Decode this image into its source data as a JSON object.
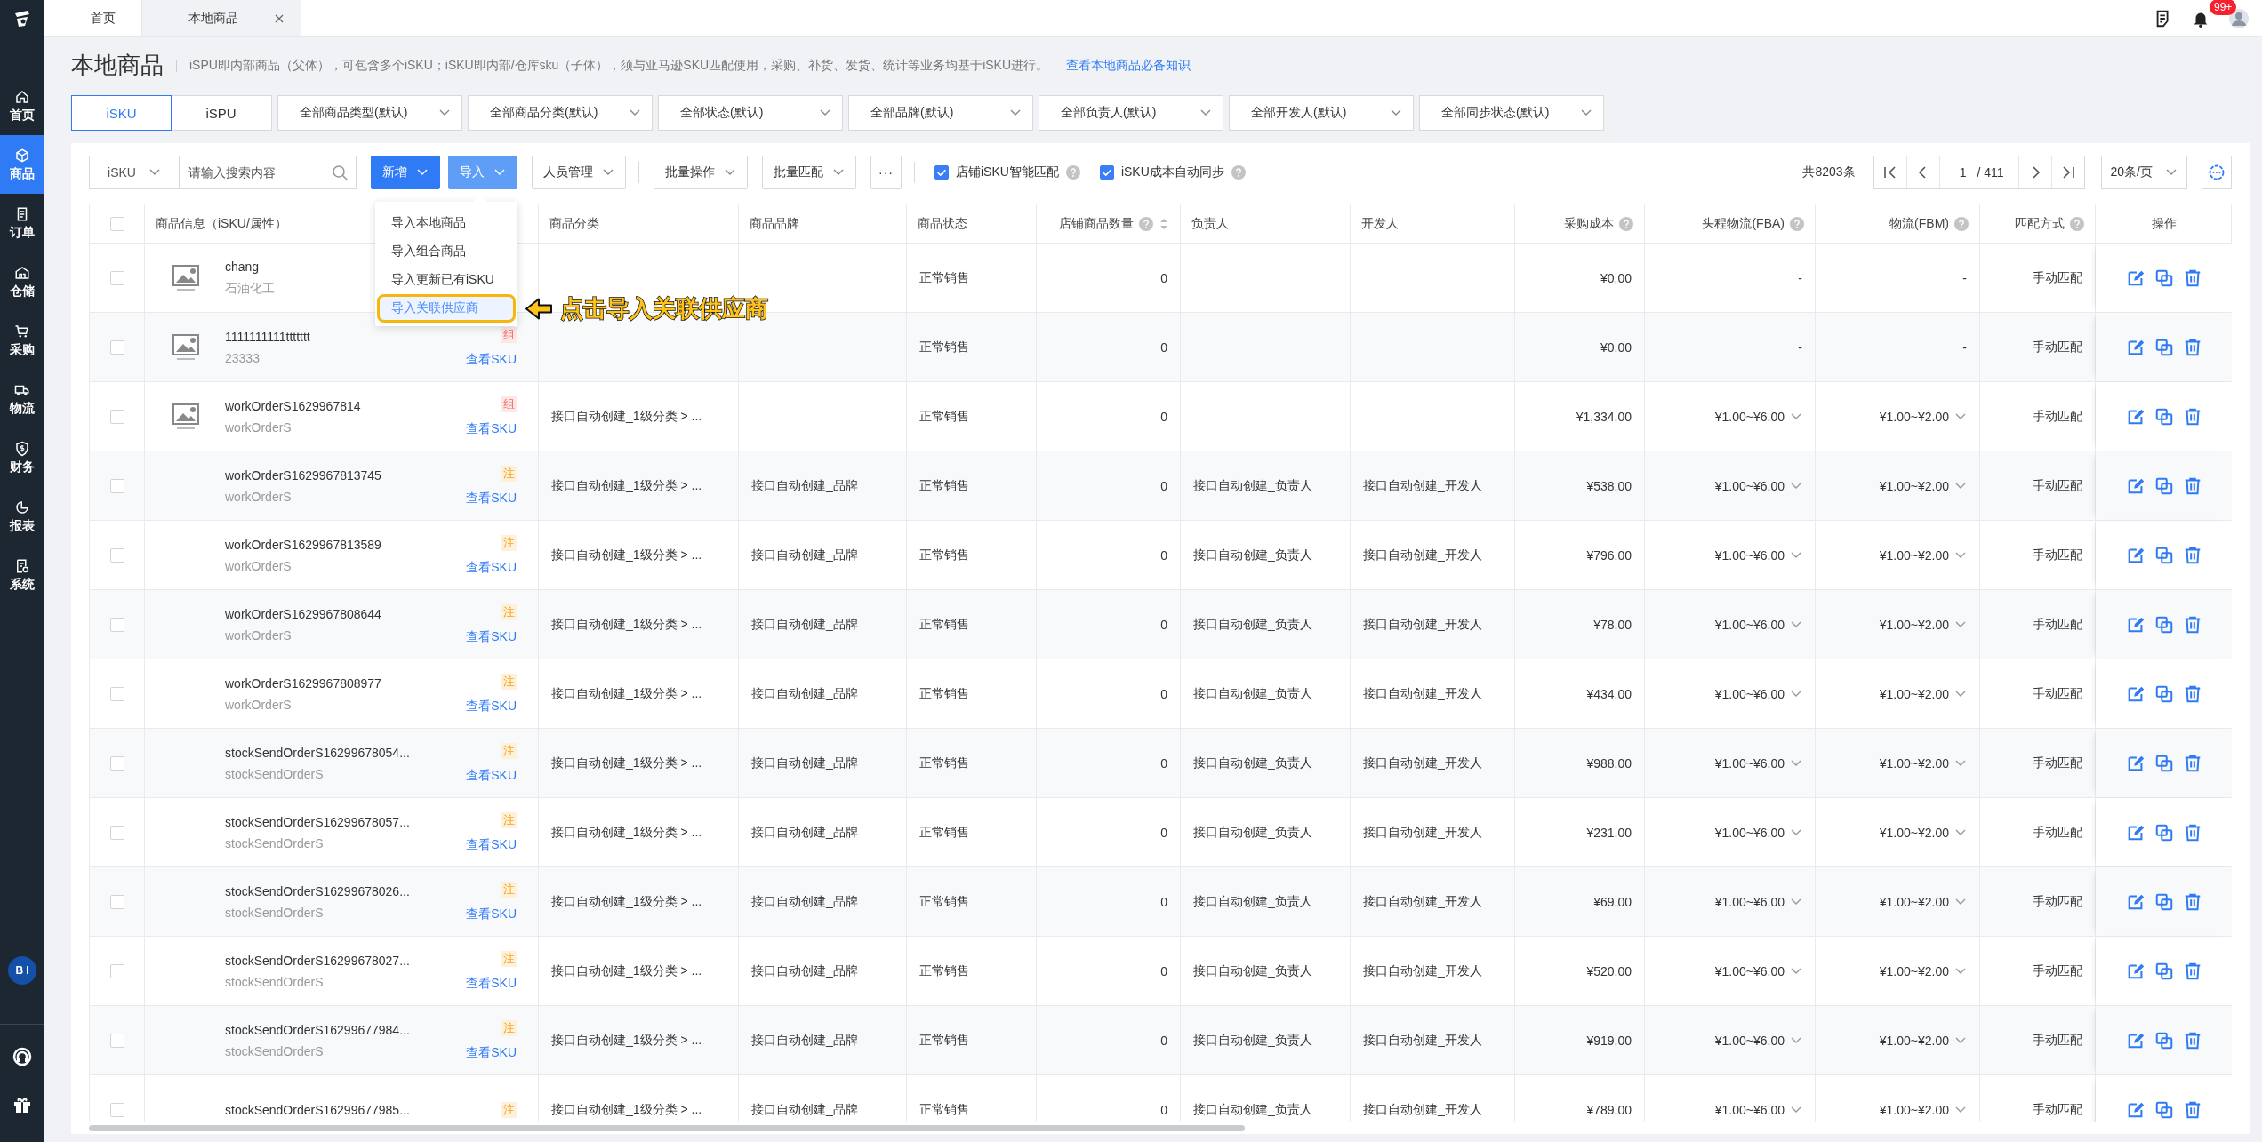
{
  "top_bar": {
    "tabs": [
      {
        "label": "首页",
        "selected": false,
        "closable": false
      },
      {
        "label": "本地商品",
        "selected": true,
        "closable": true
      }
    ],
    "notification_badge": "99+"
  },
  "sidebar": {
    "items": [
      {
        "label": "首页",
        "kind": "home",
        "selected": false
      },
      {
        "label": "商品",
        "kind": "cube",
        "selected": true
      },
      {
        "label": "订单",
        "kind": "order",
        "selected": false
      },
      {
        "label": "仓储",
        "kind": "warehouse",
        "selected": false
      },
      {
        "label": "采购",
        "kind": "cart",
        "selected": false
      },
      {
        "label": "物流",
        "kind": "truck",
        "selected": false
      },
      {
        "label": "财务",
        "kind": "finance",
        "selected": false
      },
      {
        "label": "报表",
        "kind": "chart",
        "selected": false
      },
      {
        "label": "系统",
        "kind": "system",
        "selected": false
      }
    ],
    "bi_badge": "BI"
  },
  "page_header": {
    "title": "本地商品",
    "description": "iSPU即内部商品（父体），可包含多个iSKU；iSKU即内部/仓库sku（子体），须与亚马逊SKU匹配使用，采购、补货、发货、统计等业务均基于iSKU进行。",
    "link": "查看本地商品必备知识"
  },
  "filters": {
    "segments": [
      {
        "label": "iSKU",
        "selected": true
      },
      {
        "label": "iSPU",
        "selected": false
      }
    ],
    "dropdowns": [
      "全部商品类型(默认)",
      "全部商品分类(默认)",
      "全部状态(默认)",
      "全部品牌(默认)",
      "全部负责人(默认)",
      "全部开发人(默认)",
      "全部同步状态(默认)"
    ]
  },
  "toolbar": {
    "search_scope": "iSKU",
    "search": {
      "placeholder": "请输入搜索内容"
    },
    "buttons": [
      {
        "label": "新增",
        "kind": "primary",
        "divider_before": false
      },
      {
        "label": "导入",
        "kind": "light",
        "divider_before": false
      },
      {
        "label": "人员管理",
        "kind": "dropdown",
        "divider_before": false
      },
      {
        "label": "批量操作",
        "kind": "dropdown",
        "divider_before": true
      },
      {
        "label": "批量匹配",
        "kind": "dropdown",
        "divider_before": false
      },
      {
        "label": "···",
        "kind": "plain",
        "divider_before": false
      }
    ],
    "checkboxes": [
      {
        "label": "店铺iSKU智能匹配",
        "checked": true,
        "help": true
      },
      {
        "label": "iSKU成本自动同步",
        "checked": true,
        "help": true
      }
    ],
    "pagination": {
      "total": "共8203条",
      "page": "1",
      "pages": "/ 411",
      "page_size": "20条/页"
    }
  },
  "import_menu": {
    "items": [
      {
        "label": "导入本地商品",
        "selected": false
      },
      {
        "label": "导入组合商品",
        "selected": false
      },
      {
        "label": "导入更新已有iSKU",
        "selected": false
      },
      {
        "label": "导入关联供应商",
        "selected": true
      }
    ],
    "callout": "点击导入关联供应商"
  },
  "table": {
    "columns": [
      {
        "kind": "checkbox",
        "checked": false
      },
      {
        "label": "商品信息（iSKU/属性）",
        "help": false,
        "sortable": false
      },
      {
        "label": "商品分类",
        "help": false,
        "sortable": false
      },
      {
        "label": "商品品牌",
        "help": false,
        "sortable": false
      },
      {
        "label": "商品状态",
        "help": false,
        "sortable": false
      },
      {
        "label": "店铺商品数量",
        "help": true,
        "sortable": true
      },
      {
        "label": "负责人",
        "help": false,
        "sortable": false
      },
      {
        "label": "开发人",
        "help": false,
        "sortable": false
      },
      {
        "label": "采购成本",
        "help": true,
        "sortable": false
      },
      {
        "label": "头程物流(FBA)",
        "help": true,
        "sortable": false
      },
      {
        "label": "物流(FBM)",
        "help": true,
        "sortable": false
      },
      {
        "label": "匹配方式",
        "help": true,
        "sortable": false
      },
      {
        "label": "操作",
        "help": false,
        "sortable": false
      }
    ],
    "rows": [
      {
        "checked": false,
        "has_image": true,
        "name": "chang",
        "sub": "石油化工",
        "status": "正常销售",
        "store_count": "0",
        "cost": "¥0.00",
        "fba": {
          "text": "-",
          "expandable": false
        },
        "fbm": {
          "text": "-",
          "expandable": false
        },
        "match": "手动匹配"
      },
      {
        "checked": false,
        "has_image": true,
        "name": "1111111111ttttttt",
        "sub": "23333",
        "tag": {
          "text": "组",
          "kind": "combo"
        },
        "link": "查看SKU",
        "status": "正常销售",
        "store_count": "0",
        "cost": "¥0.00",
        "fba": {
          "text": "-",
          "expandable": false
        },
        "fbm": {
          "text": "-",
          "expandable": false
        },
        "match": "手动匹配"
      },
      {
        "checked": false,
        "has_image": true,
        "name": "workOrderS1629967814",
        "sub": "workOrderS",
        "tag": {
          "text": "组",
          "kind": "combo"
        },
        "link": "查看SKU",
        "category": "接口自动创建_1级分类 > ...",
        "status": "正常销售",
        "store_count": "0",
        "cost": "¥1,334.00",
        "fba": {
          "text": "¥1.00~¥6.00",
          "expandable": true
        },
        "fbm": {
          "text": "¥1.00~¥2.00",
          "expandable": true
        },
        "match": "手动匹配"
      },
      {
        "checked": false,
        "has_image": false,
        "name": "workOrderS1629967813745",
        "sub": "workOrderS",
        "tag": {
          "text": "注",
          "kind": "note"
        },
        "link": "查看SKU",
        "category": "接口自动创建_1级分类 > ...",
        "brand": "接口自动创建_品牌",
        "status": "正常销售",
        "store_count": "0",
        "owner": "接口自动创建_负责人",
        "developer": "接口自动创建_开发人",
        "cost": "¥538.00",
        "fba": {
          "text": "¥1.00~¥6.00",
          "expandable": true
        },
        "fbm": {
          "text": "¥1.00~¥2.00",
          "expandable": true
        },
        "match": "手动匹配"
      },
      {
        "checked": false,
        "has_image": false,
        "name": "workOrderS1629967813589",
        "sub": "workOrderS",
        "tag": {
          "text": "注",
          "kind": "note"
        },
        "link": "查看SKU",
        "category": "接口自动创建_1级分类 > ...",
        "brand": "接口自动创建_品牌",
        "status": "正常销售",
        "store_count": "0",
        "owner": "接口自动创建_负责人",
        "developer": "接口自动创建_开发人",
        "cost": "¥796.00",
        "fba": {
          "text": "¥1.00~¥6.00",
          "expandable": true
        },
        "fbm": {
          "text": "¥1.00~¥2.00",
          "expandable": true
        },
        "match": "手动匹配"
      },
      {
        "checked": false,
        "has_image": false,
        "name": "workOrderS1629967808644",
        "sub": "workOrderS",
        "tag": {
          "text": "注",
          "kind": "note"
        },
        "link": "查看SKU",
        "category": "接口自动创建_1级分类 > ...",
        "brand": "接口自动创建_品牌",
        "status": "正常销售",
        "store_count": "0",
        "owner": "接口自动创建_负责人",
        "developer": "接口自动创建_开发人",
        "cost": "¥78.00",
        "fba": {
          "text": "¥1.00~¥6.00",
          "expandable": true
        },
        "fbm": {
          "text": "¥1.00~¥2.00",
          "expandable": true
        },
        "match": "手动匹配"
      },
      {
        "checked": false,
        "has_image": false,
        "name": "workOrderS1629967808977",
        "sub": "workOrderS",
        "tag": {
          "text": "注",
          "kind": "note"
        },
        "link": "查看SKU",
        "category": "接口自动创建_1级分类 > ...",
        "brand": "接口自动创建_品牌",
        "status": "正常销售",
        "store_count": "0",
        "owner": "接口自动创建_负责人",
        "developer": "接口自动创建_开发人",
        "cost": "¥434.00",
        "fba": {
          "text": "¥1.00~¥6.00",
          "expandable": true
        },
        "fbm": {
          "text": "¥1.00~¥2.00",
          "expandable": true
        },
        "match": "手动匹配"
      },
      {
        "checked": false,
        "has_image": false,
        "name": "stockSendOrderS16299678054...",
        "sub": "stockSendOrderS",
        "tag": {
          "text": "注",
          "kind": "note"
        },
        "link": "查看SKU",
        "category": "接口自动创建_1级分类 > ...",
        "brand": "接口自动创建_品牌",
        "status": "正常销售",
        "store_count": "0",
        "owner": "接口自动创建_负责人",
        "developer": "接口自动创建_开发人",
        "cost": "¥988.00",
        "fba": {
          "text": "¥1.00~¥6.00",
          "expandable": true
        },
        "fbm": {
          "text": "¥1.00~¥2.00",
          "expandable": true
        },
        "match": "手动匹配"
      },
      {
        "checked": false,
        "has_image": false,
        "name": "stockSendOrderS16299678057...",
        "sub": "stockSendOrderS",
        "tag": {
          "text": "注",
          "kind": "note"
        },
        "link": "查看SKU",
        "category": "接口自动创建_1级分类 > ...",
        "brand": "接口自动创建_品牌",
        "status": "正常销售",
        "store_count": "0",
        "owner": "接口自动创建_负责人",
        "developer": "接口自动创建_开发人",
        "cost": "¥231.00",
        "fba": {
          "text": "¥1.00~¥6.00",
          "expandable": true
        },
        "fbm": {
          "text": "¥1.00~¥2.00",
          "expandable": true
        },
        "match": "手动匹配"
      },
      {
        "checked": false,
        "has_image": false,
        "name": "stockSendOrderS16299678026...",
        "sub": "stockSendOrderS",
        "tag": {
          "text": "注",
          "kind": "note"
        },
        "link": "查看SKU",
        "category": "接口自动创建_1级分类 > ...",
        "brand": "接口自动创建_品牌",
        "status": "正常销售",
        "store_count": "0",
        "owner": "接口自动创建_负责人",
        "developer": "接口自动创建_开发人",
        "cost": "¥69.00",
        "fba": {
          "text": "¥1.00~¥6.00",
          "expandable": true
        },
        "fbm": {
          "text": "¥1.00~¥2.00",
          "expandable": true
        },
        "match": "手动匹配"
      },
      {
        "checked": false,
        "has_image": false,
        "name": "stockSendOrderS16299678027...",
        "sub": "stockSendOrderS",
        "tag": {
          "text": "注",
          "kind": "note"
        },
        "link": "查看SKU",
        "category": "接口自动创建_1级分类 > ...",
        "brand": "接口自动创建_品牌",
        "status": "正常销售",
        "store_count": "0",
        "owner": "接口自动创建_负责人",
        "developer": "接口自动创建_开发人",
        "cost": "¥520.00",
        "fba": {
          "text": "¥1.00~¥6.00",
          "expandable": true
        },
        "fbm": {
          "text": "¥1.00~¥2.00",
          "expandable": true
        },
        "match": "手动匹配"
      },
      {
        "checked": false,
        "has_image": false,
        "name": "stockSendOrderS16299677984...",
        "sub": "stockSendOrderS",
        "tag": {
          "text": "注",
          "kind": "note"
        },
        "link": "查看SKU",
        "category": "接口自动创建_1级分类 > ...",
        "brand": "接口自动创建_品牌",
        "status": "正常销售",
        "store_count": "0",
        "owner": "接口自动创建_负责人",
        "developer": "接口自动创建_开发人",
        "cost": "¥919.00",
        "fba": {
          "text": "¥1.00~¥6.00",
          "expandable": true
        },
        "fbm": {
          "text": "¥1.00~¥2.00",
          "expandable": true
        },
        "match": "手动匹配"
      },
      {
        "checked": false,
        "has_image": false,
        "name": "stockSendOrderS16299677985...",
        "tag": {
          "text": "注",
          "kind": "note"
        },
        "category": "接口自动创建_1级分类 > ...",
        "brand": "接口自动创建_品牌",
        "status": "正常销售",
        "store_count": "0",
        "owner": "接口自动创建_负责人",
        "developer": "接口自动创建_开发人",
        "cost": "¥789.00",
        "fba": {
          "text": "¥1.00~¥6.00",
          "expandable": true
        },
        "fbm": {
          "text": "¥1.00~¥2.00",
          "expandable": true
        },
        "match": "手动匹配"
      }
    ]
  }
}
